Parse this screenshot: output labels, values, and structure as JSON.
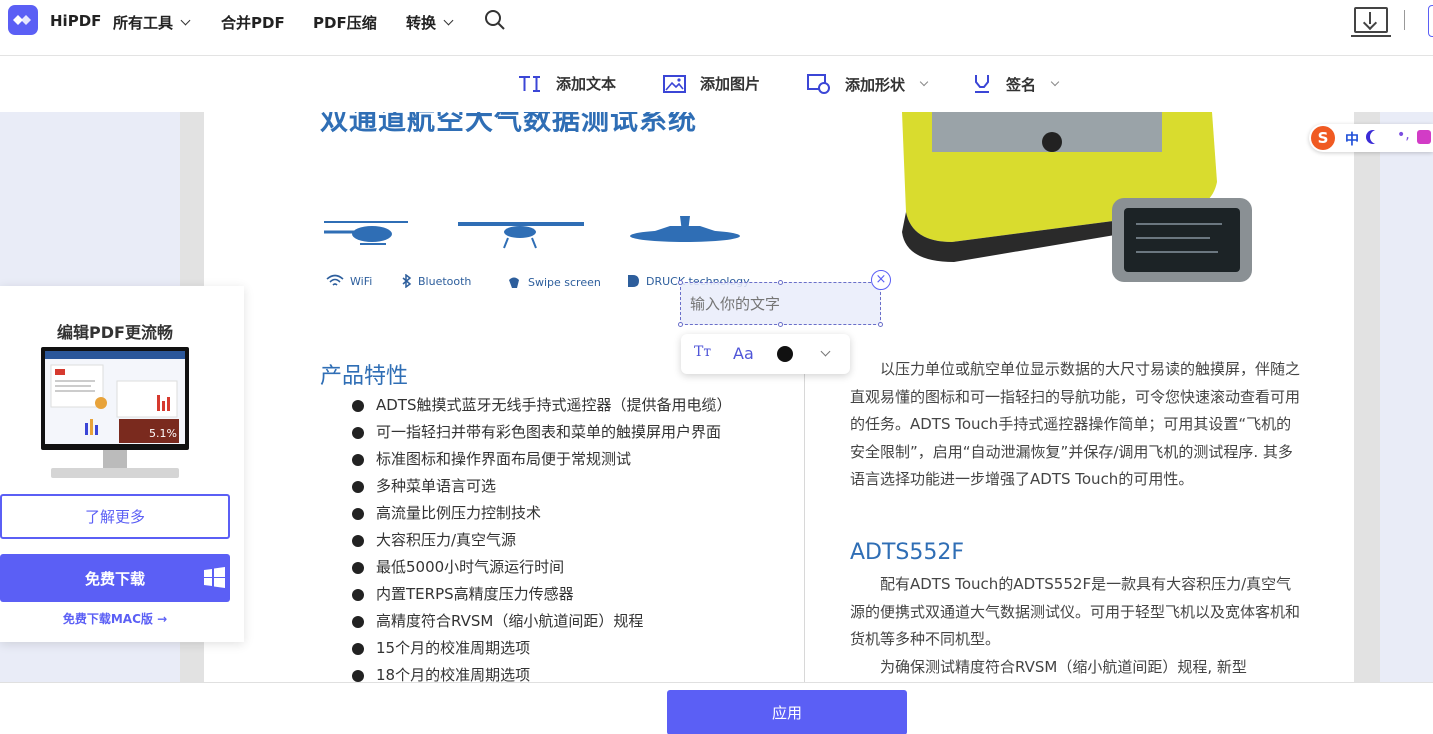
{
  "nav": {
    "brand": "HiPDF",
    "items": [
      {
        "label": "所有工具",
        "has_dropdown": true
      },
      {
        "label": "合并PDF",
        "has_dropdown": false
      },
      {
        "label": "PDF压缩",
        "has_dropdown": false
      },
      {
        "label": "转换",
        "has_dropdown": true
      }
    ],
    "icons": {
      "search": "search-icon",
      "download": "desktop-download-icon"
    }
  },
  "toolbar": {
    "items": [
      {
        "label": "添加文本",
        "icon": "text-icon"
      },
      {
        "label": "添加图片",
        "icon": "image-icon"
      },
      {
        "label": "添加形状",
        "icon": "shape-icon",
        "has_dropdown": true
      },
      {
        "label": "签名",
        "icon": "signature-pen-icon",
        "has_dropdown": true
      }
    ]
  },
  "document": {
    "title": "双通道航空大气数据测试系统",
    "features": [
      "WiFi",
      "Bluetooth",
      "Swipe screen",
      "DRUCK technology"
    ],
    "section1": {
      "title": "产品特性",
      "bullets": [
        "ADTS触摸式蓝牙无线手持式遥控器（提供备用电缆）",
        "可一指轻扫并带有彩色图表和菜单的触摸屏用户界面",
        "标准图标和操作界面布局便于常规测试",
        "多种菜单语言可选",
        "高流量比例压力控制技术",
        "大容积压力/真空气源",
        "最低5000小时气源运行时间",
        "内置TERPS高精度压力传感器",
        "高精度符合RVSM（缩小航道间距）规程",
        "15个月的校准周期选项",
        "18个月的校准周期选项"
      ]
    },
    "para1": "以压力单位或航空单位显示数据的大尺寸易读的触摸屏，伴随之直观易懂的图标和可一指轻扫的导航功能，可令您快速滚动查看可用的任务。ADTS Touch手持式遥控器操作简单；可用其设置“飞机的安全限制”，启用“自动泄漏恢复”并保存/调用飞机的测试程序. 其多语言选择功能进一步增强了ADTS Touch的可用性。",
    "section2": {
      "title": "ADTS552F",
      "para": "配有ADTS Touch的ADTS552F是一款具有大容积压力/真空气源的便携式双通道大气数据测试仪。可用于轻型飞机以及宽体客机和货机等多种不同机型。",
      "para2": "为确保测试精度符合RVSM（缩小航道间距）规程, 新型"
    }
  },
  "textbox": {
    "placeholder": "输入你的文字",
    "close": "×"
  },
  "format_bar": {
    "text_style": "Tт",
    "font": "Aa",
    "color": "#111111"
  },
  "promo": {
    "title": "编辑PDF更流畅",
    "screen_value": "5.1%",
    "learn_more": "了解更多",
    "download": "免费下载",
    "mac_download": "免费下载MAC版",
    "mac_arrow": "→"
  },
  "ime": {
    "logo": "S",
    "mode": "中",
    "dots": "•,"
  },
  "bottom": {
    "apply": "应用"
  },
  "colors": {
    "accent": "#5b5ff5",
    "doc_blue": "#2f6eb5"
  }
}
